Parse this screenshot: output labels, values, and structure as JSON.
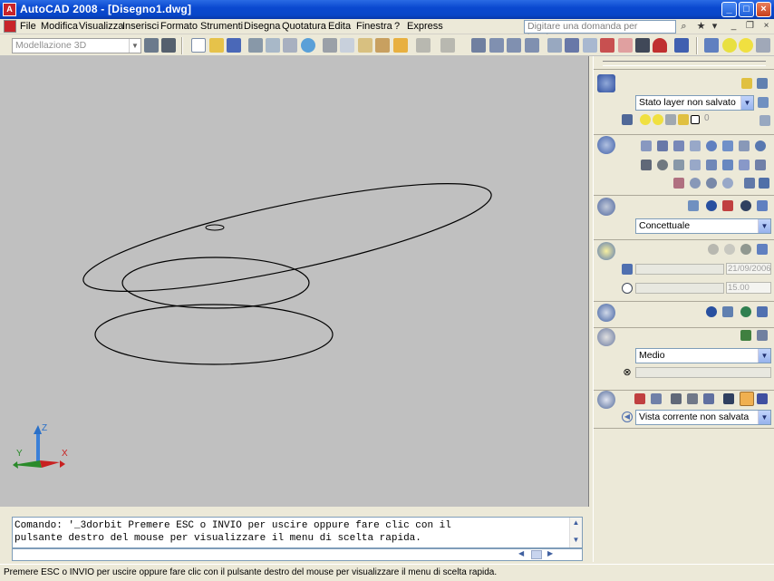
{
  "window": {
    "title": "AutoCAD 2008 - [Disegno1.dwg]"
  },
  "menu": {
    "items": [
      "File",
      "Modifica",
      "Visualizza",
      "Inserisci",
      "Formato",
      "Strumenti",
      "Disegna",
      "Quotatura",
      "Edita",
      "Finestra",
      "?",
      "Express"
    ]
  },
  "help": {
    "placeholder": "Digitare una domanda per l'assistenza"
  },
  "toolbar": {
    "workspace": "Modellazione 3D"
  },
  "ucs": {
    "x_label": "X",
    "y_label": "Y",
    "z_label": "Z"
  },
  "command": {
    "line1": "Comando: '_3dorbit Premere ESC o INVIO per uscire oppure fare clic con il",
    "line2": "pulsante destro del mouse per visualizzare il menu di scelta rapida."
  },
  "statusbar": {
    "text": "Premere ESC o INVIO per uscire oppure fare clic con il pulsante destro del mouse per visualizzare il menu di scelta rapida."
  },
  "dashboard": {
    "layer_state": "Stato layer non salvato",
    "layer_value": "0",
    "visual_style": "Concettuale",
    "date": "21/09/2006",
    "time": "15.00",
    "material_quality": "Medio",
    "view": "Vista corrente non salvata"
  },
  "colors": {
    "title_bar": "#0a49d0",
    "drawing_bg": "#c0c0c0",
    "chrome": "#ece9d8"
  }
}
